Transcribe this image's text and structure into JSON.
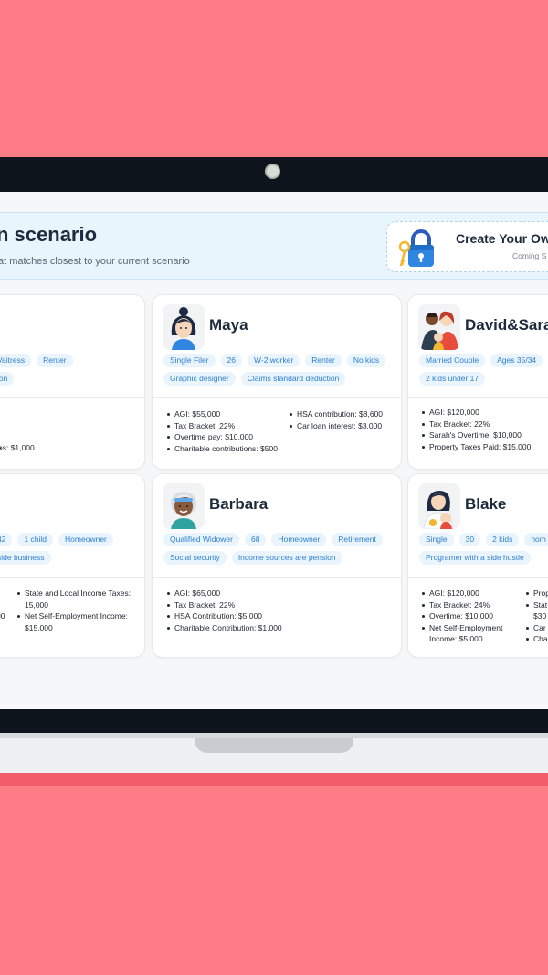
{
  "header": {
    "title": "n scenario",
    "subtitle": "at matches closest to your current scenario",
    "create": {
      "title": "Create Your Ow",
      "subtitle": "Coming S"
    }
  },
  "cards": [
    {
      "name": "",
      "tags": [
        [
          "Vaitress",
          "Renter"
        ],
        [
          "ion"
        ]
      ],
      "facts": [
        [],
        [
          "ns: $1,000"
        ]
      ]
    },
    {
      "name": "Maya",
      "tags": [
        [
          "Single Filer",
          "26",
          "W-2 worker",
          "Renter",
          "No kids"
        ],
        [
          "Graphic designer",
          "Claims standard deduction"
        ]
      ],
      "facts": [
        [
          "AGI: $55,000",
          "Tax Bracket: 22%",
          "Overtime pay: $10,000",
          "Charitable contributions: $500"
        ],
        [
          "HSA contribution: $8,600",
          "Car loan interest: $3,000"
        ]
      ]
    },
    {
      "name": "David&Sara",
      "tags": [
        [
          "Married Couple",
          "Ages 35/34"
        ],
        [
          "2 kids under 17"
        ]
      ],
      "facts": [
        [
          "AGI: $120,000",
          "Tax Bracket: 22%",
          "Sarah's Overtime: $10,000",
          "Property Taxes Paid: $15,000"
        ],
        [
          "I",
          "("
        ]
      ]
    },
    {
      "name": "",
      "tags": [
        [
          "42",
          "1 child",
          "Homeowner"
        ],
        [
          "side business"
        ]
      ],
      "facts": [
        [
          "",
          "",
          "00"
        ],
        [
          "State and Local Income Taxes: 15,000",
          "Net Self-Employment Income: $15,000"
        ]
      ]
    },
    {
      "name": "Barbara",
      "tags": [
        [
          "Qualified Widower",
          "68",
          "Homeowner",
          "Retirement"
        ],
        [
          "Social security",
          "Income sources are pension"
        ]
      ],
      "facts": [
        [
          "AGI: $65,000",
          "Tax Bracket: 22%",
          "HSA Contribution: $5,000",
          "Charitable Contribution: $1,000"
        ],
        []
      ]
    },
    {
      "name": "Blake",
      "tags": [
        [
          "Single",
          "30",
          "2 kids",
          "hom"
        ],
        [
          "Programer with a side hustle"
        ]
      ],
      "facts": [
        [
          "AGI: $120,000",
          "Tax Bracket: 24%",
          "Overtime: $10,000",
          "Net Self-Employment Income: $5,000"
        ],
        [
          "Prop",
          "Stat $30",
          "Car",
          "Cha"
        ]
      ]
    }
  ]
}
